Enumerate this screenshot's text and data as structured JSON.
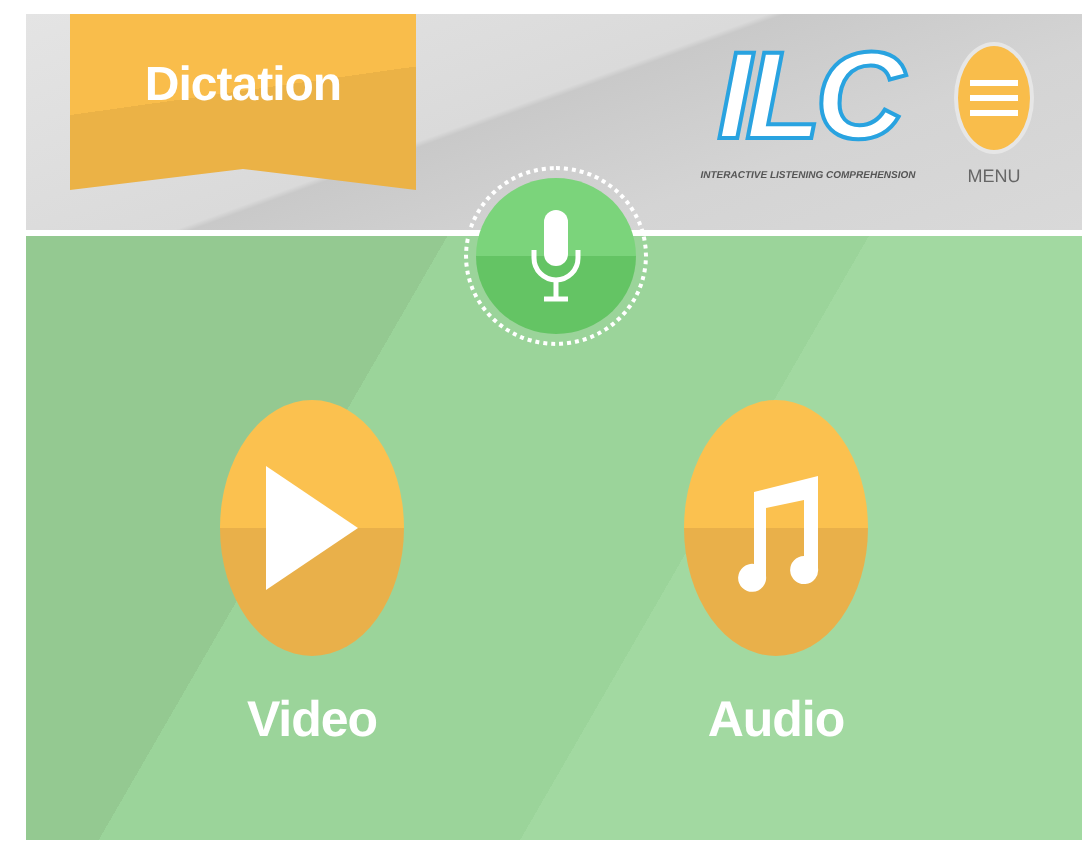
{
  "header": {
    "title": "Dictation",
    "logo": {
      "text": "ILC",
      "tagline": "INTERACTIVE LISTENING COMPREHENSION"
    },
    "menu": {
      "label": "MENU"
    }
  },
  "options": [
    {
      "label": "Video",
      "kind": "video"
    },
    {
      "label": "Audio",
      "kind": "audio"
    }
  ]
}
